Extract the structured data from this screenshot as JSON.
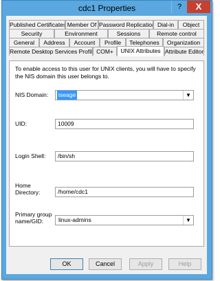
{
  "window": {
    "title": "cdc1 Properties",
    "help_icon": "?",
    "close_icon": "X"
  },
  "tabs": {
    "row1": [
      "Published Certificates",
      "Member Of",
      "Password Replication",
      "Dial-in",
      "Object"
    ],
    "row2": [
      "Security",
      "Environment",
      "Sessions",
      "Remote control"
    ],
    "row3": [
      "General",
      "Address",
      "Account",
      "Profile",
      "Telephones",
      "Organization"
    ],
    "row4": [
      "Remote Desktop Services Profile",
      "COM+",
      "UNIX Attributes",
      "Attribute Editor"
    ],
    "active": "UNIX Attributes"
  },
  "panel": {
    "intro": "To enable access to this user for UNIX clients, you will have to specify the NIS domain this user belongs to.",
    "nis_domain": {
      "label": "NIS Domain:",
      "value": "iseage"
    },
    "uid": {
      "label": "UID:",
      "value": "10009"
    },
    "login_shell": {
      "label": "Login Shell:",
      "value": "/bin/sh"
    },
    "home_directory": {
      "label_line1": "Home",
      "label_line2": "Directory:",
      "value": "/home/cdc1"
    },
    "primary_group": {
      "label_line1": "Primary group",
      "label_line2": "name/GID:",
      "value": "linux-admins"
    }
  },
  "buttons": {
    "ok": "OK",
    "cancel": "Cancel",
    "apply": "Apply",
    "help": "Help"
  }
}
